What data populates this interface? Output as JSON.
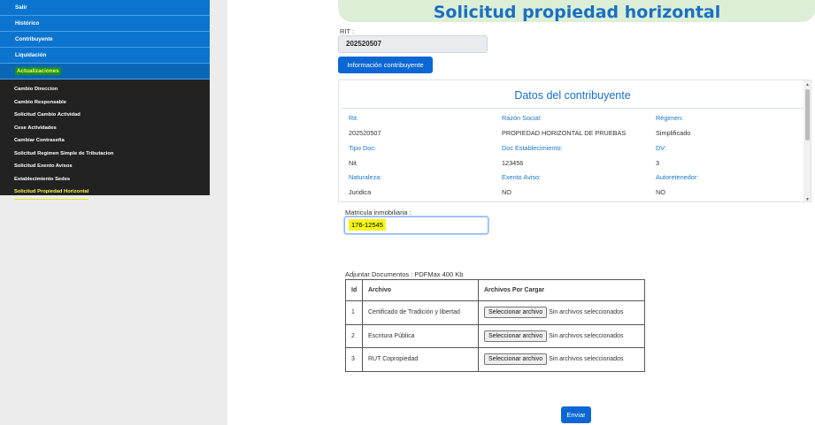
{
  "menu": {
    "top_items": [
      {
        "label": "Salir"
      },
      {
        "label": "Histórico"
      },
      {
        "label": "Contribuyente"
      },
      {
        "label": "Liquidación"
      },
      {
        "label": "Actualizaciones"
      }
    ],
    "sub_items": [
      {
        "label": "Cambio Direccion"
      },
      {
        "label": "Cambio Responsable"
      },
      {
        "label": "Solicitud Cambio Actividad"
      },
      {
        "label": "Cese Actividades"
      },
      {
        "label": "Cambiar Contraseña"
      },
      {
        "label": "Solicitud Regimen Simple de Tributacion"
      },
      {
        "label": "Solicitud Exento Avisos"
      },
      {
        "label": "Establecimiento Sedes"
      },
      {
        "label": "Solicitud Propiedad Horizontal"
      }
    ]
  },
  "page": {
    "title": "Solicitud propiedad horizontal"
  },
  "rit": {
    "label": "RIT :",
    "value": "202520507"
  },
  "info_button": "Información contribuyente",
  "contribuyente": {
    "title": "Datos del contribuyente",
    "fields": [
      {
        "label": "Rit:",
        "value": "202520507"
      },
      {
        "label": "Razón Social:",
        "value": "PROPIEDAD HORIZONTAL DE PRUEBAS"
      },
      {
        "label": "Régimen:",
        "value": "Simplificado"
      },
      {
        "label": "Tipo Doc:",
        "value": "Nit"
      },
      {
        "label": "Doc Establecimiento:",
        "value": "123456"
      },
      {
        "label": "DV:",
        "value": "3"
      },
      {
        "label": "Naturaleza:",
        "value": "Juridica"
      },
      {
        "label": "Exento Aviso:",
        "value": "NO"
      },
      {
        "label": "Autoretenedor:",
        "value": "NO"
      }
    ]
  },
  "matricula": {
    "label": "Matricula inmobiliaria :",
    "value": "176-12545"
  },
  "documents": {
    "label": "Adjuntar Documentos : PDFMax 400 Kb",
    "headers": [
      "Id",
      "Archivo",
      "Archivos Por Cargar"
    ],
    "rows": [
      {
        "id": "1",
        "archivo": "Certificado de Tradición y libertad",
        "button": "Seleccionar archivo",
        "status": "Sin archivos seleccionados"
      },
      {
        "id": "2",
        "archivo": "Escritura Pública",
        "button": "Seleccionar archivo",
        "status": "Sin archivos seleccionados"
      },
      {
        "id": "3",
        "archivo": "RUT Copropiedad",
        "button": "Seleccionar archivo",
        "status": "Sin archivos seleccionados"
      }
    ]
  },
  "send_button": "Enviar",
  "colors": {
    "primary": "#0b67d3",
    "menu_blue": "#0b74cf",
    "menu_dark": "#222222",
    "title_blue": "#1a6fc3",
    "highlight_yellow": "#f5f51c",
    "banner_green": "#dcefd6"
  }
}
